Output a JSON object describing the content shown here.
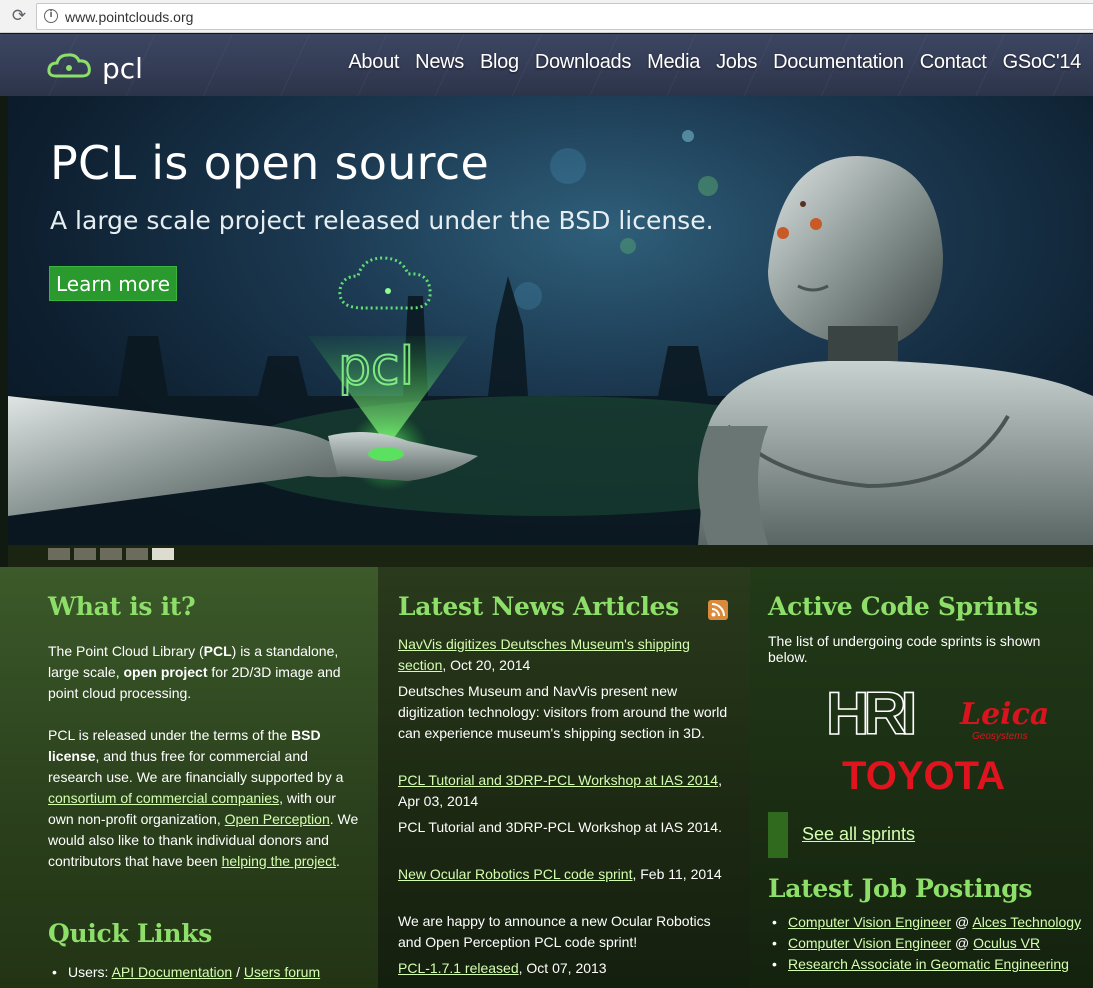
{
  "browser": {
    "url": "www.pointclouds.org"
  },
  "header": {
    "logo_text": "pcl",
    "nav": [
      "About",
      "News",
      "Blog",
      "Downloads",
      "Media",
      "Jobs",
      "Documentation",
      "Contact",
      "GSoC'14"
    ]
  },
  "hero": {
    "title": "PCL is open source",
    "subtitle": "A large scale project released under the BSD license.",
    "button": "Learn more",
    "hologram_text": "pcl",
    "slides": 5,
    "active_slide": 5
  },
  "what_is_it": {
    "heading": "What is it?",
    "p1_a": "The Point Cloud Library (",
    "p1_b": "PCL",
    "p1_c": ") is a standalone, large scale, ",
    "p1_d": "open project",
    "p1_e": " for 2D/3D image and point cloud processing.",
    "p2_a": "PCL is released under the terms of the ",
    "p2_b": "BSD license",
    "p2_c": ", and thus free for commercial and research use. We are financially supported by a ",
    "p2_link1": "consortium of commercial companies",
    "p2_d": ", with our own non-profit organization, ",
    "p2_link2": "Open Perception",
    "p2_e": ". We would also like to thank individual donors and contributors that have been ",
    "p2_link3": "helping the project",
    "p2_f": "."
  },
  "quick_links": {
    "heading": "Quick Links",
    "item_prefix": "Users: ",
    "link1": "API Documentation",
    "sep": " / ",
    "link2": "Users forum"
  },
  "news": {
    "heading": "Latest News Articles",
    "items": [
      {
        "link": "NavVis digitizes Deutsches Museum's shipping section",
        "date": ", Oct 20, 2014",
        "body": "Deutsches Museum and NavVis present new digitization technology: visitors from around the world can experience museum's shipping section in 3D."
      },
      {
        "link": "PCL Tutorial and 3DRP-PCL Workshop at IAS 2014",
        "date": ", Apr 03, 2014",
        "body": "PCL Tutorial and 3DRP-PCL Workshop at IAS 2014."
      },
      {
        "link": "New Ocular Robotics PCL code sprint",
        "date": ", Feb 11, 2014",
        "body": "We are happy to announce a new Ocular Robotics and Open Perception PCL code sprint!"
      },
      {
        "link": "PCL-1.7.1 released",
        "date": ", Oct 07, 2013",
        "body": ""
      }
    ]
  },
  "sprints": {
    "heading": "Active Code Sprints",
    "intro": "The list of undergoing code sprints is shown below.",
    "logos": {
      "hri": "HRI",
      "leica": "Leica",
      "leica_sub": "Geosystems",
      "toyota": "TOYOTA"
    },
    "see_all": "See all sprints"
  },
  "jobs": {
    "heading": "Latest Job Postings",
    "items": [
      {
        "title": "Computer Vision Engineer",
        "at": " @ ",
        "company": "Alces Technology"
      },
      {
        "title": "Computer Vision Engineer",
        "at": " @ ",
        "company": "Oculus VR"
      },
      {
        "title": "Research Associate in Geomatic Engineering",
        "at": "",
        "company": ""
      }
    ]
  },
  "colors": {
    "heading_green": "#8ddf6a",
    "button_green": "#2a9a2e",
    "link": "#d4ffb0",
    "toyota_red": "#e0141e",
    "leica_red": "#d9141e"
  }
}
